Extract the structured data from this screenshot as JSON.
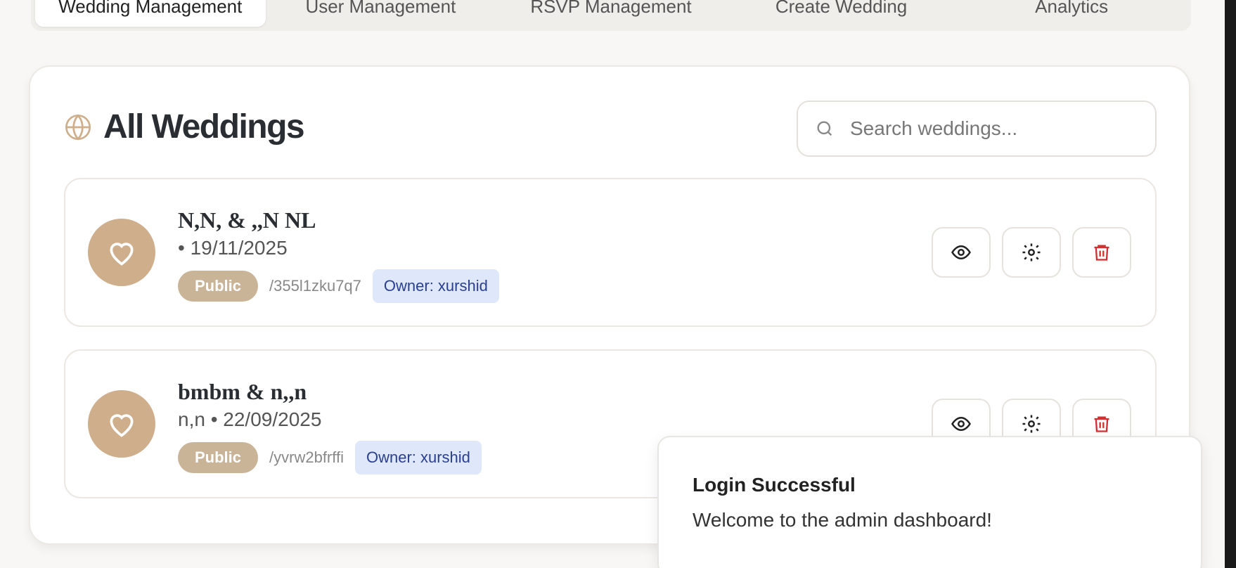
{
  "tabs": [
    {
      "label": "Wedding Management",
      "active": true
    },
    {
      "label": "User Management",
      "active": false
    },
    {
      "label": "RSVP Management",
      "active": false
    },
    {
      "label": "Create Wedding",
      "active": false
    },
    {
      "label": "Analytics",
      "active": false
    }
  ],
  "card": {
    "title": "All Weddings",
    "icon": "globe-icon",
    "search": {
      "placeholder": "Search weddings...",
      "value": ""
    }
  },
  "weddings": [
    {
      "name": "N,N, & ,,N NL",
      "date": "• 19/11/2025",
      "visibility": "Public",
      "slug": "/355l1zku7q7",
      "owner": "Owner: xurshid"
    },
    {
      "name": "bmbm & n,,n",
      "date": "n,n • 22/09/2025",
      "visibility": "Public",
      "slug": "/yvrw2bfrffi",
      "owner": "Owner: xurshid"
    }
  ],
  "toast": {
    "title": "Login Successful",
    "message": "Welcome to the admin dashboard!"
  },
  "colors": {
    "accent": "#cfae8c",
    "badge": "#c9b498",
    "danger": "#d32f2f",
    "owner_bg": "#dfe8fa",
    "owner_text": "#2b3f91"
  }
}
